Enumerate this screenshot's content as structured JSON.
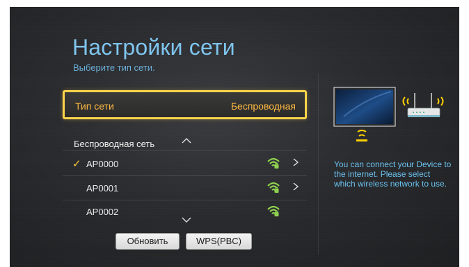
{
  "header": {
    "title": "Настройки сети",
    "subtitle": "Выберите тип сети."
  },
  "network_type": {
    "label": "Тип сети",
    "value": "Беспроводная"
  },
  "wireless": {
    "header": "Беспроводная сеть",
    "networks": [
      {
        "name": "AP0000",
        "selected": true,
        "has_arrow": true
      },
      {
        "name": "AP0001",
        "selected": false,
        "has_arrow": true
      },
      {
        "name": "AP0002",
        "selected": false,
        "has_arrow": false
      }
    ],
    "check_glyph": "✓"
  },
  "buttons": {
    "refresh": "Обновить",
    "wps": "WPS(PBC)"
  },
  "info_text": "You can connect your Device to the internet. Please select which wireless network to use.",
  "icons": {
    "chevron_up": "chevron-up-icon",
    "chevron_down": "chevron-down-icon",
    "wifi": "wifi-signal-icon",
    "arrow": "chevron-right-icon",
    "illustration": "tv-router-illustration"
  },
  "colors": {
    "accent_blue": "#7fc5ef",
    "focus_yellow": "#ffd44a",
    "label_orange": "#ffb93f",
    "wifi_green": "#8fd14f"
  }
}
